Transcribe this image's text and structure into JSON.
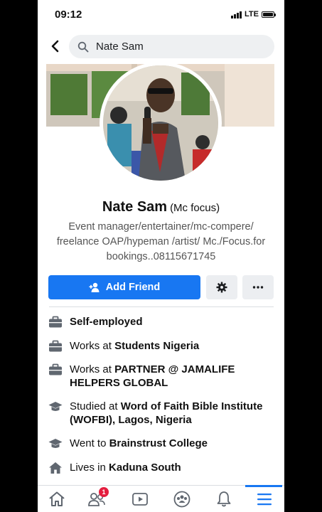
{
  "status_bar": {
    "time": "09:12",
    "network": "LTE"
  },
  "search": {
    "query": "Nate Sam"
  },
  "profile": {
    "name": "Nate Sam",
    "nickname": "(Mc focus)",
    "bio": "Event manager/entertainer/mc-compere/ freelance OAP/hypeman /artist/ Mc./Focus.for bookings..08115671745"
  },
  "actions": {
    "add_friend_label": "Add Friend"
  },
  "info": [
    {
      "icon": "briefcase-icon",
      "prefix": "",
      "bold": "Self-employed"
    },
    {
      "icon": "briefcase-icon",
      "prefix": "Works at ",
      "bold": "Students Nigeria"
    },
    {
      "icon": "briefcase-icon",
      "prefix": "Works at ",
      "bold": "PARTNER @ JAMALIFE HELPERS GLOBAL"
    },
    {
      "icon": "graduation-cap-icon",
      "prefix": "Studied at ",
      "bold": "Word of Faith Bible Institute (WOFBI), Lagos, Nigeria"
    },
    {
      "icon": "graduation-cap-icon",
      "prefix": "Went to ",
      "bold": "Brainstrust College"
    },
    {
      "icon": "house-icon",
      "prefix": "Lives in ",
      "bold": "Kaduna South"
    }
  ],
  "nav": {
    "friends_badge": "1"
  },
  "colors": {
    "accent": "#1877f2",
    "badge": "#e41e3f"
  }
}
